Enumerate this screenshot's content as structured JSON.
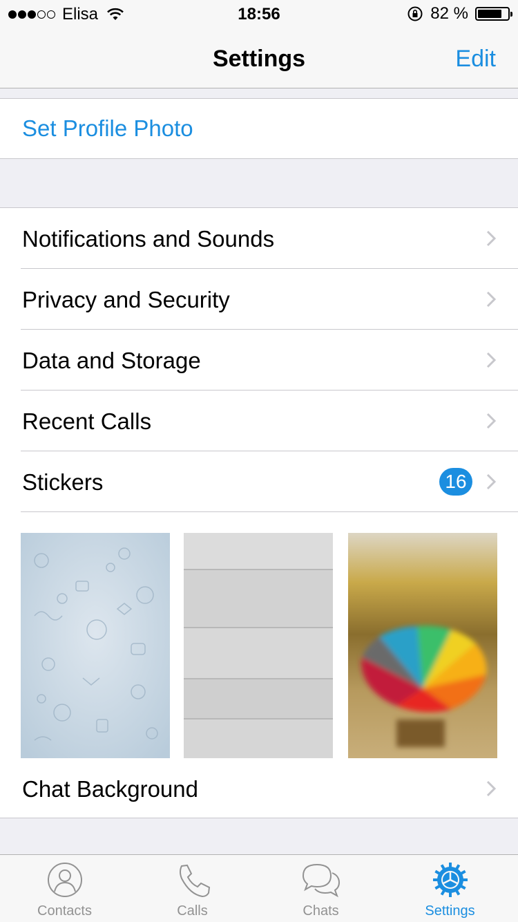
{
  "status_bar": {
    "carrier": "Elisa",
    "time": "18:56",
    "battery_percent": "82 %",
    "battery_level": 0.82,
    "signal_bars": 3,
    "signal_total": 5
  },
  "nav": {
    "title": "Settings",
    "edit_label": "Edit"
  },
  "profile": {
    "set_photo_label": "Set Profile Photo"
  },
  "settings_items": [
    {
      "label": "Notifications and Sounds"
    },
    {
      "label": "Privacy and Security"
    },
    {
      "label": "Data and Storage"
    },
    {
      "label": "Recent Calls"
    },
    {
      "label": "Stickers",
      "badge": "16"
    }
  ],
  "chat_background": {
    "label": "Chat Background",
    "thumbnails": [
      "pattern-doodles",
      "white-wood",
      "rainbow-umbrella"
    ]
  },
  "tabs": [
    {
      "label": "Contacts",
      "icon": "person-icon"
    },
    {
      "label": "Calls",
      "icon": "phone-icon"
    },
    {
      "label": "Chats",
      "icon": "chat-bubbles-icon"
    },
    {
      "label": "Settings",
      "icon": "gear-icon",
      "active": true
    }
  ],
  "colors": {
    "accent": "#1b8ee0",
    "inactive_tab": "#929292",
    "background": "#efeff4"
  }
}
